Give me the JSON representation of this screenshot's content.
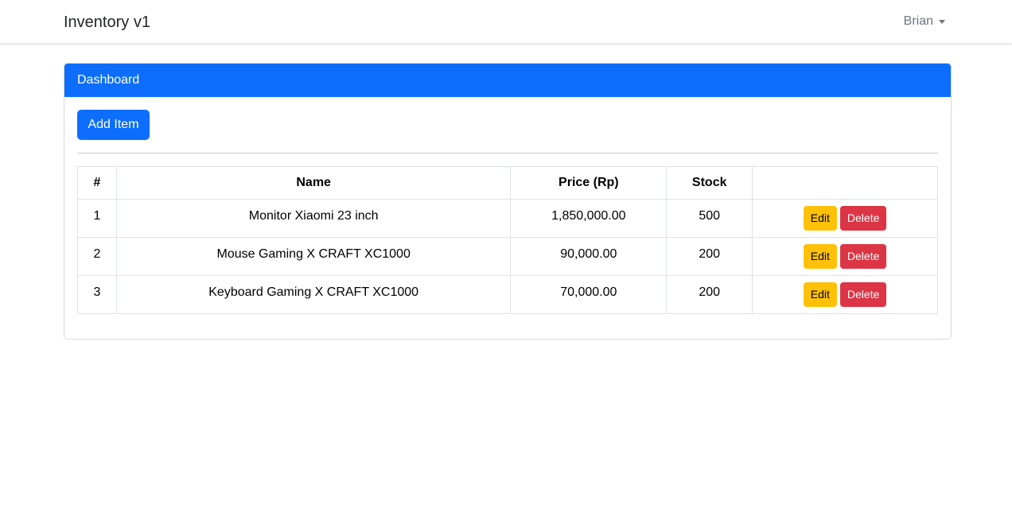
{
  "navbar": {
    "brand": "Inventory v1",
    "user": "Brian"
  },
  "card": {
    "header": "Dashboard",
    "add_button": "Add Item"
  },
  "table": {
    "headers": [
      "#",
      "Name",
      "Price (Rp)",
      "Stock",
      ""
    ],
    "rows": [
      {
        "no": "1",
        "name": "Monitor Xiaomi 23 inch",
        "price": "1,850,000.00",
        "stock": "500"
      },
      {
        "no": "2",
        "name": "Mouse Gaming X CRAFT XC1000",
        "price": "90,000.00",
        "stock": "200"
      },
      {
        "no": "3",
        "name": "Keyboard Gaming X CRAFT XC1000",
        "price": "70,000.00",
        "stock": "200"
      }
    ],
    "edit_label": "Edit",
    "delete_label": "Delete"
  },
  "colors": {
    "primary": "#0d6efd",
    "warning": "#ffc107",
    "danger": "#dc3545"
  }
}
